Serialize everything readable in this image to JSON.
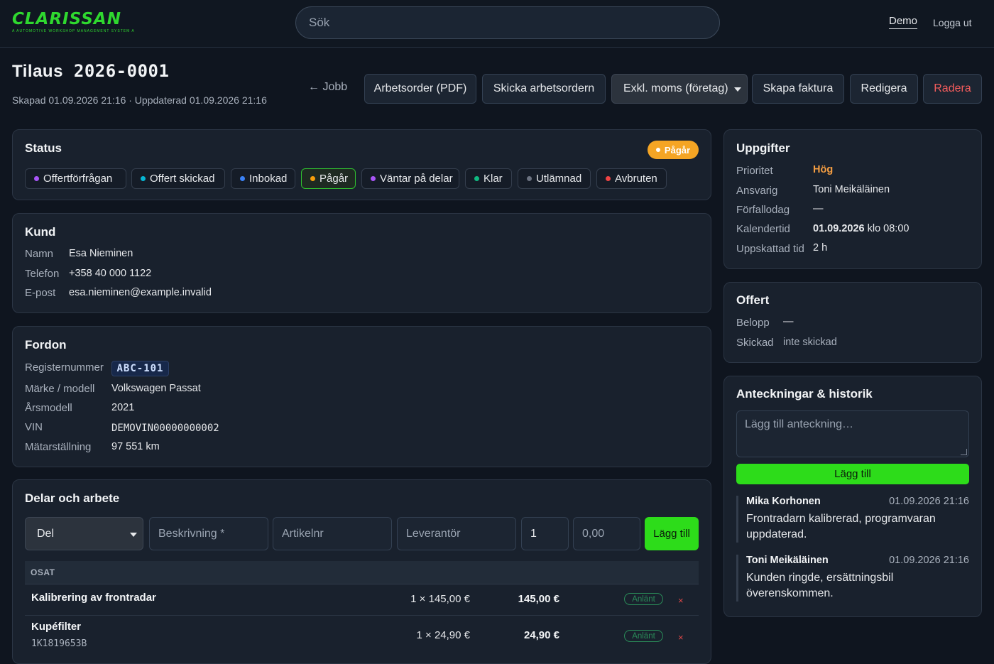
{
  "header": {
    "logo_text": "CLARISSAN",
    "logo_tagline": "A AUTOMOTIVE WORKSHOP MANAGEMENT SYSTEM A",
    "search_placeholder": "Sök",
    "demo_label": "Demo",
    "logout_label": "Logga ut"
  },
  "order": {
    "title_label": "Tilaus",
    "title_number": "2026-0001",
    "meta": "Skapad 01.09.2026 21:16 · Uppdaterad 01.09.2026 21:16"
  },
  "toolbar": {
    "back": "← Jobb",
    "pdf": "Arbetsorder (PDF)",
    "send": "Skicka arbetsordern",
    "vat_select": "Exkl. moms (företag)",
    "invoice": "Skapa faktura",
    "edit": "Redigera",
    "delete": "Radera"
  },
  "status": {
    "title": "Status",
    "current": "Pågår",
    "current_color": "#f5a524",
    "options": [
      {
        "label": "Offertförfrågan",
        "color": "#a855f7"
      },
      {
        "label": "Offert skickad",
        "color": "#06b6d4"
      },
      {
        "label": "Inbokad",
        "color": "#3b82f6"
      },
      {
        "label": "Pågår",
        "color": "#f59e0b"
      },
      {
        "label": "Väntar på delar",
        "color": "#a855f7"
      },
      {
        "label": "Klar",
        "color": "#10b981"
      },
      {
        "label": "Utlämnad",
        "color": "#6b7280"
      },
      {
        "label": "Avbruten",
        "color": "#ef4444"
      }
    ]
  },
  "customer": {
    "title": "Kund",
    "name_label": "Namn",
    "name": "Esa Nieminen",
    "phone_label": "Telefon",
    "phone": "+358 40 000 1122",
    "email_label": "E-post",
    "email": "esa.nieminen@example.invalid"
  },
  "vehicle": {
    "title": "Fordon",
    "reg_label": "Registernummer",
    "reg": "ABC-101",
    "model_label": "Märke / modell",
    "model": "Volkswagen Passat",
    "year_label": "Årsmodell",
    "year": "2021",
    "vin_label": "VIN",
    "vin": "DEMOVIN00000000002",
    "odo_label": "Mätarställning",
    "odo": "97 551 km"
  },
  "parts": {
    "title": "Delar och arbete",
    "type_select": "Del",
    "desc_placeholder": "Beskrivning *",
    "article_placeholder": "Artikelnr",
    "supplier_placeholder": "Leverantör",
    "qty_value": "1",
    "price_placeholder": "0,00",
    "add_label": "Lägg till",
    "section_header": "OSAT",
    "rows": [
      {
        "name": "Kalibrering av frontradar",
        "sub": "",
        "qty": "1 × 145,00 €",
        "total": "145,00 €",
        "status": "Anlänt",
        "delete": "×"
      },
      {
        "name": "Kupéfilter",
        "sub": "1K1819653B",
        "qty": "1 × 24,90 €",
        "total": "24,90 €",
        "status": "Anlänt",
        "delete": "×"
      }
    ]
  },
  "details": {
    "title": "Uppgifter",
    "priority_label": "Prioritet",
    "priority": "Hög",
    "priority_color": "#f59e42",
    "assignee_label": "Ansvarig",
    "assignee": "Toni Meikäläinen",
    "due_label": "Förfallodag",
    "due": "—",
    "calendar_label": "Kalendertid",
    "calendar_date": "01.09.2026",
    "calendar_time": "klo 08:00",
    "estimate_label": "Uppskattad tid",
    "estimate": "2 h"
  },
  "quote": {
    "title": "Offert",
    "amount_label": "Belopp",
    "amount": "—",
    "sent_label": "Skickad",
    "sent": "inte skickad"
  },
  "notes": {
    "title": "Anteckningar & historik",
    "placeholder": "Lägg till anteckning…",
    "add_label": "Lägg till",
    "items": [
      {
        "author": "Mika Korhonen",
        "time": "01.09.2026 21:16",
        "text": "Frontradarn kalibrerad, programvaran uppdaterad."
      },
      {
        "author": "Toni Meikäläinen",
        "time": "01.09.2026 21:16",
        "text": "Kunden ringde, ersättningsbil överenskommen."
      }
    ]
  }
}
